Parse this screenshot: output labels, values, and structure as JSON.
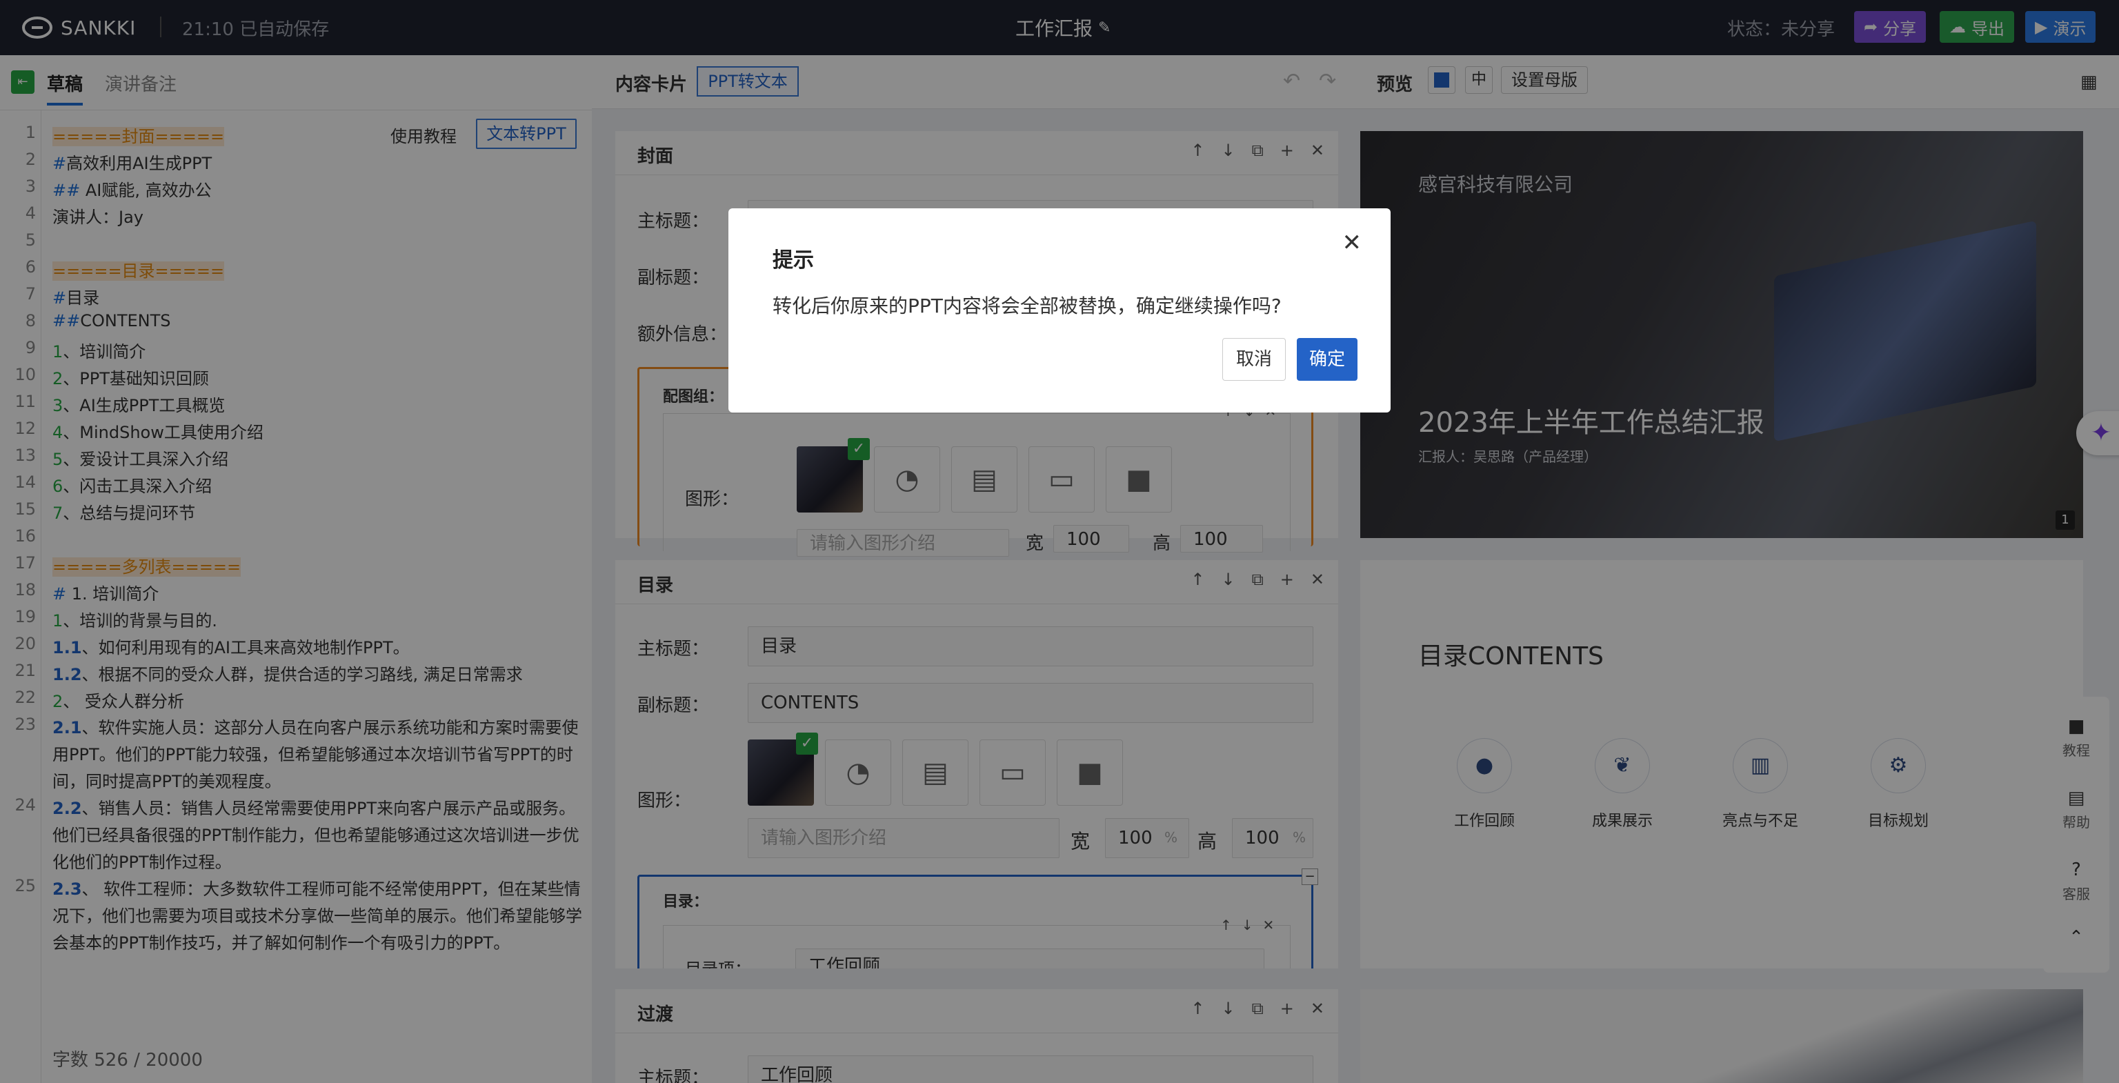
{
  "topbar": {
    "logo_text": "SANKKI",
    "autosave": "21:10 已自动保存",
    "doc_title": "工作汇报",
    "status": "状态：未分享",
    "share": "分享",
    "export": "导出",
    "present": "演示",
    "colors": {
      "share": "#7b4fd8",
      "export": "#2ea44f",
      "present": "#2d7be5"
    }
  },
  "left_tabs": {
    "draft": "草稿",
    "notes": "演讲备注"
  },
  "editor": {
    "tutorial_link": "使用教程",
    "to_ppt_button": "文本转PPT",
    "word_count": "字数  526 / 20000",
    "lines": [
      {
        "n": "1",
        "text": "=====封面====="
      },
      {
        "n": "2",
        "prefix": "#",
        "text": "高效利用AI生成PPT"
      },
      {
        "n": "3",
        "prefix": "##",
        "text": " AI赋能, 高效办公"
      },
      {
        "n": "4",
        "text": "演讲人：Jay"
      },
      {
        "n": "5",
        "text": ""
      },
      {
        "n": "6",
        "text": "=====目录====="
      },
      {
        "n": "7",
        "prefix": "#",
        "text": "目录"
      },
      {
        "n": "8",
        "prefix": "##",
        "text": "CONTENTS"
      },
      {
        "n": "9",
        "prefix": "1",
        "text": "、培训简介"
      },
      {
        "n": "10",
        "prefix": "2",
        "text": "、PPT基础知识回顾"
      },
      {
        "n": "11",
        "prefix": "3",
        "text": "、AI生成PPT工具概览"
      },
      {
        "n": "12",
        "prefix": "4",
        "text": "、MindShow工具使用介绍"
      },
      {
        "n": "13",
        "prefix": "5",
        "text": "、爱设计工具深入介绍"
      },
      {
        "n": "14",
        "prefix": "6",
        "text": "、闪击工具深入介绍"
      },
      {
        "n": "15",
        "prefix": "7",
        "text": "、总结与提问环节"
      },
      {
        "n": "16",
        "text": ""
      },
      {
        "n": "17",
        "text": "=====多列表====="
      },
      {
        "n": "18",
        "prefix": "#",
        "text": " 1. 培训简介"
      },
      {
        "n": "19",
        "prefix": "1",
        "text": "、培训的背景与目的."
      },
      {
        "n": "20",
        "prefix": "1.1",
        "text": "、如何利用现有的AI工具来高效地制作PPT。"
      },
      {
        "n": "21",
        "prefix": "1.2",
        "text": "、根据不同的受众人群，提供合适的学习路线, 满足日常需求"
      },
      {
        "n": "22",
        "prefix": "2",
        "text": "、 受众人群分析"
      },
      {
        "n": "23",
        "prefix": "2.1",
        "text": "、软件实施人员：这部分人员在向客户展示系统功能和方案时需要使用PPT。他们的PPT能力较强，但希望能够通过本次培训节省写PPT的时间，同时提高PPT的美观程度。"
      },
      {
        "n": "24",
        "prefix": "2.2",
        "text": "、销售人员：销售人员经常需要使用PPT来向客户展示产品或服务。他们已经具备很强的PPT制作能力，但也希望能够通过这次培训进一步优化他们的PPT制作过程。"
      },
      {
        "n": "25",
        "prefix": "2.3",
        "text": "、 软件工程师：大多数软件工程师可能不经常使用PPT，但在某些情况下，他们也需要为项目或技术分享做一些简单的展示。他们希望能够学会基本的PPT制作技巧，并了解如何制作一个有吸引力的PPT。"
      }
    ]
  },
  "middle": {
    "title": "内容卡片",
    "ppt_to_text": "PPT转文本",
    "preview": "预览",
    "zoom": "中",
    "master": "设置母版"
  },
  "cards": {
    "cover": {
      "title": "封面",
      "main_label": "主标题：",
      "sub_label": "副标题：",
      "extra_label": "额外信息：",
      "img_group": "配图组：",
      "shape_label": "图形：",
      "shape_placeholder": "请输入图形介绍",
      "width_label": "宽",
      "height_label": "高",
      "width_val": "100",
      "height_val": "100",
      "unit": "%"
    },
    "toc": {
      "title": "目录",
      "main_label": "主标题：",
      "main_val": "目录",
      "sub_label": "副标题：",
      "sub_val": "CONTENTS",
      "shape_label": "图形：",
      "shape_placeholder": "请输入图形介绍",
      "width_label": "宽",
      "height_label": "高",
      "width_val": "100",
      "height_val": "100",
      "unit": "%",
      "toc_group": "目录：",
      "toc_item_label": "目录项：",
      "toc_item_val": "工作回顾"
    },
    "transition": {
      "title": "过渡",
      "main_label": "主标题：",
      "main_val": "工作回顾"
    }
  },
  "slides": {
    "cover": {
      "company": "感官科技有限公司",
      "title": "2023年上半年工作总结汇报",
      "reporter": "汇报人：吴思路（产品经理）",
      "page": "1"
    },
    "toc": {
      "title": "目录CONTENTS",
      "items": [
        "工作回顾",
        "成果展示",
        "亮点与不足",
        "目标规划"
      ]
    }
  },
  "side_buttons": {
    "tutorial": "教程",
    "help": "帮助",
    "service": "客服"
  },
  "dialog": {
    "title": "提示",
    "message": "转化后你原来的PPT内容将会全部被替换，确定继续操作吗?",
    "cancel": "取消",
    "ok": "确定"
  }
}
